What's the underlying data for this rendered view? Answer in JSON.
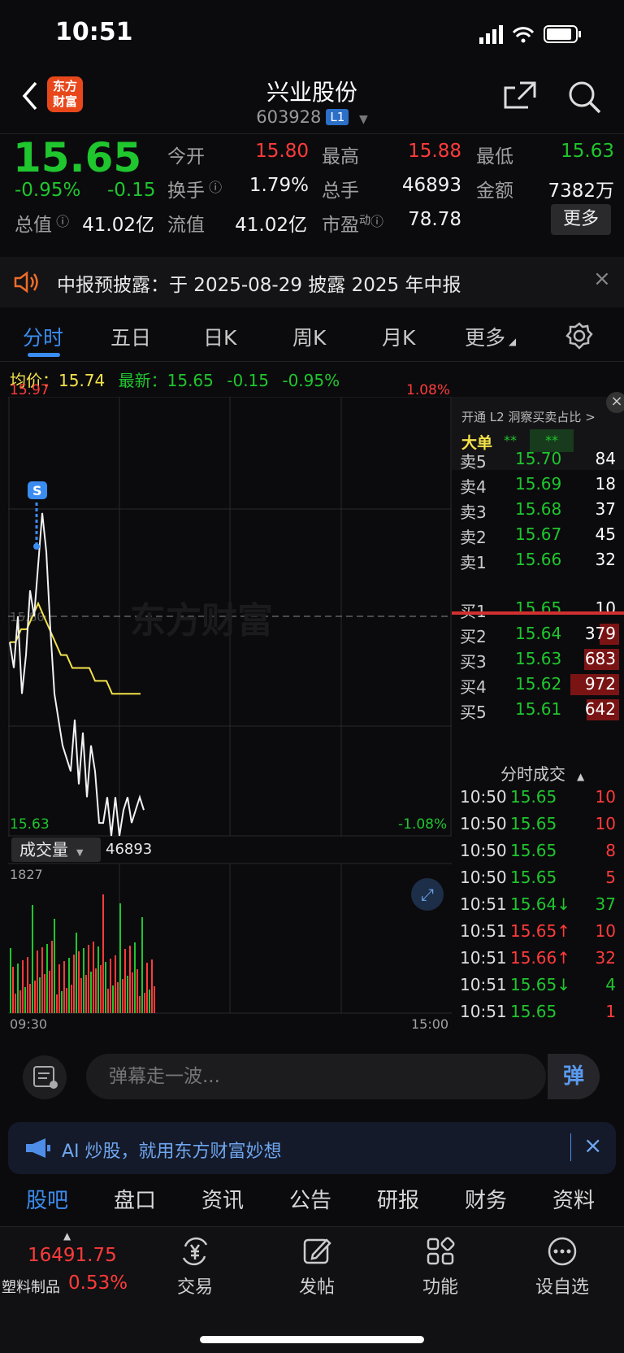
{
  "status": {
    "time": "10:51"
  },
  "header": {
    "logo_line1": "东方",
    "logo_line2": "财富",
    "title": "兴业股份",
    "code": "603928",
    "level": "L1"
  },
  "quote": {
    "price": "15.65",
    "pct": "-0.95%",
    "change": "-0.15",
    "open_label": "今开",
    "open": "15.80",
    "high_label": "最高",
    "high": "15.88",
    "low_label": "最低",
    "low": "15.63",
    "turnover_label": "换手",
    "turnover": "1.79%",
    "volume_label": "总手",
    "volume": "46893",
    "amount_label": "金额",
    "amount": "7382万",
    "mktcap_label": "总值",
    "mktcap": "41.02亿",
    "float_label": "流值",
    "float": "41.02亿",
    "pe_label": "市盈",
    "pe_sup": "动",
    "pe": "78.78",
    "more": "更多"
  },
  "notice": {
    "text": "中报预披露：于 2025-08-29 披露 2025 年中报"
  },
  "tabs": [
    "分时",
    "五日",
    "日K",
    "周K",
    "月K",
    "更多"
  ],
  "chart_info": {
    "avg_label": "均价：",
    "avg": "15.74",
    "latest_label": "最新：",
    "latest": "15.65",
    "chg": "-0.15",
    "pct": "-0.95%"
  },
  "chart": {
    "y_max": "15.97",
    "y_min": "15.63",
    "pct_max": "1.08%",
    "pct_min": "-1.08%",
    "watermark": "东方财富",
    "mid": "15.80",
    "marker": "S",
    "vol_label": "成交量",
    "vol_total": "46893",
    "vol_max": "1827",
    "time_start": "09:30",
    "time_end": "15:00"
  },
  "chart_data": {
    "type": "line",
    "x_range": [
      "09:30",
      "15:00"
    ],
    "ylim": [
      15.63,
      15.97
    ],
    "series": [
      {
        "values": [
          15.78,
          15.76,
          15.8,
          15.74,
          15.77,
          15.82,
          15.8,
          15.84,
          15.88,
          15.85,
          15.79,
          15.74,
          15.72,
          15.7,
          15.69,
          15.68,
          15.72,
          15.67,
          15.71,
          15.66,
          15.7,
          15.68,
          15.64,
          15.64,
          15.66,
          15.63,
          15.66,
          15.63,
          15.65,
          15.66,
          15.64,
          15.65,
          15.66,
          15.65
        ]
      },
      {
        "values": [
          15.78,
          15.78,
          15.79,
          15.79,
          15.8,
          15.81,
          15.8,
          15.79,
          15.78,
          15.77,
          15.77,
          15.76,
          15.76,
          15.76,
          15.76,
          15.75,
          15.75,
          15.75,
          15.74,
          15.74,
          15.74,
          15.74,
          15.74,
          15.74
        ]
      }
    ]
  },
  "orderbook": {
    "head": "开通 L2 洞察买卖占比 >",
    "big_label": "大单",
    "big1": "**",
    "big2": "**",
    "asks": [
      {
        "label": "卖5",
        "price": "15.70",
        "vol": "84"
      },
      {
        "label": "卖4",
        "price": "15.69",
        "vol": "18"
      },
      {
        "label": "卖3",
        "price": "15.68",
        "vol": "37"
      },
      {
        "label": "卖2",
        "price": "15.67",
        "vol": "45"
      },
      {
        "label": "卖1",
        "price": "15.66",
        "vol": "32"
      }
    ],
    "bids": [
      {
        "label": "买1",
        "price": "15.65",
        "vol": "10"
      },
      {
        "label": "买2",
        "price": "15.64",
        "vol": "379"
      },
      {
        "label": "买3",
        "price": "15.63",
        "vol": "683"
      },
      {
        "label": "买4",
        "price": "15.62",
        "vol": "972"
      },
      {
        "label": "买5",
        "price": "15.61",
        "vol": "642"
      }
    ],
    "trades_title": "分时成交",
    "trades": [
      {
        "t": "10:50",
        "p": "15.65",
        "v": "10"
      },
      {
        "t": "10:50",
        "p": "15.65",
        "v": "10"
      },
      {
        "t": "10:50",
        "p": "15.65",
        "v": "8"
      },
      {
        "t": "10:50",
        "p": "15.65",
        "v": "5"
      },
      {
        "t": "10:51",
        "p": "15.64↓",
        "v": "37"
      },
      {
        "t": "10:51",
        "p": "15.65↑",
        "v": "10"
      },
      {
        "t": "10:51",
        "p": "15.66↑",
        "v": "32"
      },
      {
        "t": "10:51",
        "p": "15.65↓",
        "v": "4"
      },
      {
        "t": "10:51",
        "p": "15.65",
        "v": "1"
      }
    ]
  },
  "input": {
    "placeholder": "弹幕走一波...",
    "send": "弹"
  },
  "ai": {
    "text": "AI 炒股，就用东方财富妙想"
  },
  "subtabs": [
    "股吧",
    "盘口",
    "资讯",
    "公告",
    "研报",
    "财务",
    "资料"
  ],
  "bottom": {
    "index_value": "16491.75",
    "index_name": "塑料制品",
    "index_pct": "0.53%",
    "items": [
      "交易",
      "发帖",
      "功能",
      "设自选"
    ]
  },
  "colors": {
    "up": "#ff3b3b",
    "down": "#1fc62e",
    "avg_line": "#f3e24a",
    "accent": "#2c6fc7"
  }
}
